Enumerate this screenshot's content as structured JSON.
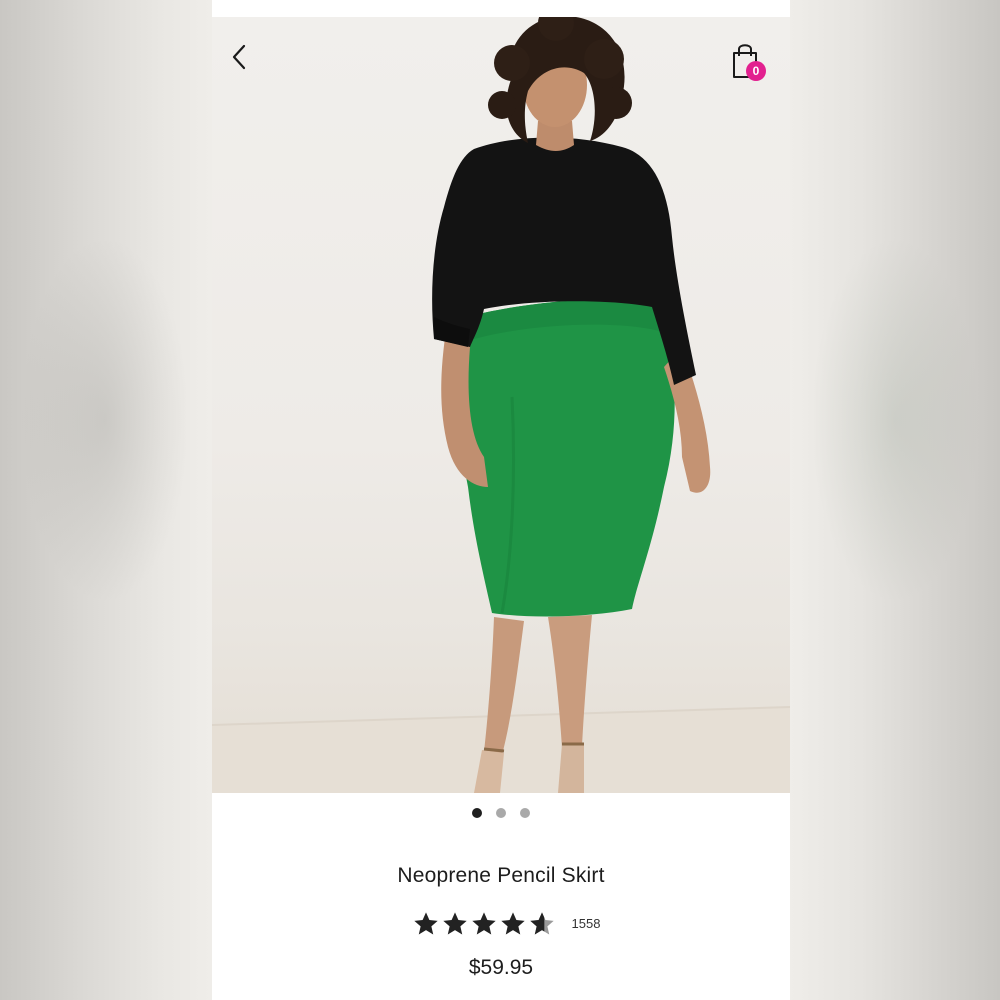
{
  "product": {
    "title": "Neoprene Pencil Skirt",
    "price": "$59.95",
    "rating": 4.6,
    "rating_max": 5,
    "review_count": "1558"
  },
  "header": {
    "back_icon": "chevron-left-icon",
    "cart_icon": "shopping-bag-icon",
    "cart_count": "0"
  },
  "gallery": {
    "image_count": 3,
    "active_index": 0,
    "image_description_icon": "product-photo"
  },
  "colors": {
    "badge": "#e2208f",
    "skirt": "#1f9446",
    "top": "#111111",
    "star": "#222222",
    "dot_active": "#1f1f1f",
    "dot_inactive": "#a9a9a9"
  }
}
